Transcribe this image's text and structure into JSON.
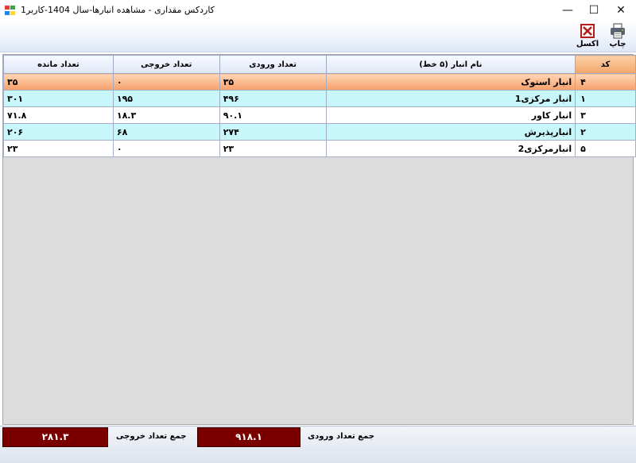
{
  "window": {
    "title": "کاردکس مقداری  - مشاهده انبارها-سال 1404-کاربر1",
    "minimize": "—",
    "maximize": "☐",
    "close": "✕"
  },
  "toolbar": {
    "print_label": "چاپ",
    "excel_label": "اکسل"
  },
  "grid": {
    "columns": {
      "code": "کد",
      "name": "نام انبار (۵ خط)",
      "inbound": "تعداد ورودی",
      "outbound": "تعداد خروجی",
      "remaining": "تعداد مانده"
    },
    "rows": [
      {
        "code": "۴",
        "name": "انبار استوک",
        "inbound": "۳۵",
        "outbound": "۰",
        "remaining": "۳۵"
      },
      {
        "code": "۱",
        "name": "انبار مرکزی1",
        "inbound": "۴۹۶",
        "outbound": "۱۹۵",
        "remaining": "۳۰۱"
      },
      {
        "code": "۳",
        "name": "انبار کاور",
        "inbound": "۹۰.۱",
        "outbound": "۱۸.۳",
        "remaining": "۷۱.۸"
      },
      {
        "code": "۲",
        "name": "انبارپذیرش",
        "inbound": "۲۷۴",
        "outbound": "۶۸",
        "remaining": "۲۰۶"
      },
      {
        "code": "۵",
        "name": "انبارمرکزی2",
        "inbound": "۲۳",
        "outbound": "۰",
        "remaining": "۲۳"
      }
    ]
  },
  "footer": {
    "total_inbound_label": "جمع تعداد ورودی",
    "total_inbound_value": "۹۱۸.۱",
    "total_outbound_label": "جمع تعداد خروجی",
    "total_outbound_value": "۲۸۱.۳"
  },
  "colors": {
    "total_box": "#7a0000",
    "selected_row": "#f6a06a",
    "alt_row": "#c8f7fb"
  }
}
